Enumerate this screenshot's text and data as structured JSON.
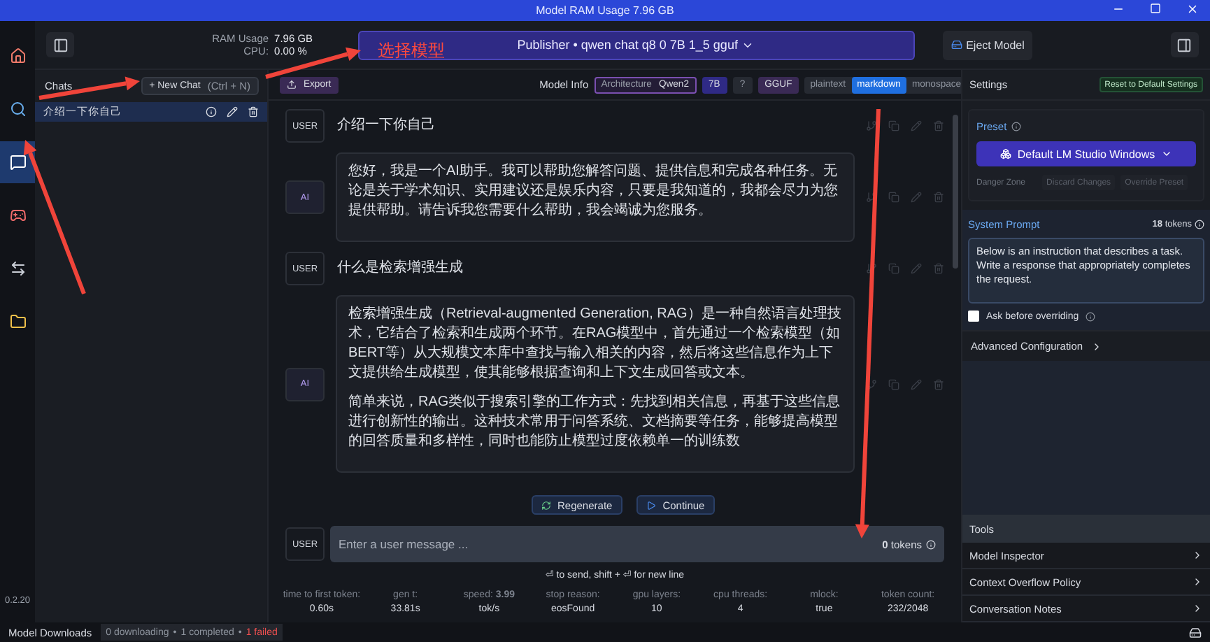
{
  "window": {
    "title": "Model RAM Usage  7.96 GB"
  },
  "nav_rail": {
    "items": [
      {
        "selected": false
      },
      {
        "selected": false
      },
      {
        "selected": true
      },
      {
        "selected": false
      },
      {
        "selected": false
      },
      {
        "selected": false
      }
    ],
    "version": "0.2.20"
  },
  "top_bar": {
    "ram_label": "RAM Usage",
    "ram_value": "7.96 GB",
    "cpu_label": "CPU:",
    "cpu_value": "0.00 %",
    "model_selector": "Publisher • qwen chat q8 0 7B 1_5 gguf",
    "eject_button": "Eject Model"
  },
  "annotation": {
    "label": "选择模型"
  },
  "chats": {
    "title": "Chats",
    "new_chat": "+ New Chat",
    "shortcut": "(Ctrl + N)",
    "items": [
      {
        "title": "介绍一下你自己",
        "selected": true
      }
    ]
  },
  "toolbar": {
    "export": "Export",
    "model_info_label": "Model Info",
    "architecture_label": "Architecture",
    "architecture_value": "Qwen2",
    "chips": [
      {
        "kind": "size",
        "label": "7B"
      },
      {
        "kind": "unknown",
        "label": "?"
      },
      {
        "kind": "format",
        "label": "GGUF"
      }
    ],
    "formats": [
      {
        "label": "plaintext",
        "selected": false
      },
      {
        "label": "markdown",
        "selected": true
      },
      {
        "label": "monospace",
        "selected": false
      }
    ]
  },
  "messages": [
    {
      "role": "USER",
      "paragraphs": [
        "介绍一下你自己"
      ]
    },
    {
      "role": "AI",
      "paragraphs": [
        "您好，我是一个AI助手。我可以帮助您解答问题、提供信息和完成各种任务。无论是关于学术知识、实用建议还是娱乐内容，只要是我知道的，我都会尽力为您提供帮助。请告诉我您需要什么帮助，我会竭诚为您服务。"
      ]
    },
    {
      "role": "USER",
      "paragraphs": [
        "什么是检索增强生成"
      ]
    },
    {
      "role": "AI",
      "paragraphs": [
        "检索增强生成（Retrieval-augmented Generation, RAG）是一种自然语言处理技术，它结合了检索和生成两个环节。在RAG模型中，首先通过一个检索模型（如BERT等）从大规模文本库中查找与输入相关的内容，然后将这些信息作为上下文提供给生成模型，使其能够根据查询和上下文生成回答或文本。",
        "简单来说，RAG类似于搜索引擎的工作方式：先找到相关信息，再基于这些信息进行创新性的输出。这种技术常用于问答系统、文档摘要等任务，能够提高模型的回答质量和多样性，同时也能防止模型过度依赖单一的训练数"
      ]
    }
  ],
  "actions": {
    "regenerate": "Regenerate",
    "continue": "Continue"
  },
  "composer": {
    "role": "USER",
    "placeholder": "Enter a user message ...",
    "tokens_value": "0",
    "tokens_label": "tokens",
    "hint": "⏎ to send, shift + ⏎ for new line"
  },
  "stats": [
    {
      "label": "time to first token:",
      "value": "0.60s"
    },
    {
      "label": "gen t:",
      "value": "33.81s"
    },
    {
      "label": "speed: **3.99**",
      "value": "tok/s"
    },
    {
      "label": "stop reason:",
      "value": "eosFound"
    },
    {
      "label": "gpu layers:",
      "value": "10"
    },
    {
      "label": "cpu threads:",
      "value": "4"
    },
    {
      "label": "mlock:",
      "value": "true"
    },
    {
      "label": "token count:",
      "value": "232/2048"
    }
  ],
  "settings": {
    "title": "Settings",
    "reset": "Reset to Default Settings",
    "preset_label": "Preset",
    "preset_value": "Default LM Studio Windows",
    "danger_zone": "Danger Zone",
    "discard": "Discard Changes",
    "override": "Override Preset",
    "system_prompt_label": "System Prompt",
    "system_prompt_tokens": "18",
    "system_prompt_tokens_label": "tokens",
    "system_prompt": "Below is an instruction that describes a task. Write a response that appropriately completes the request.",
    "ask_before_overriding": {
      "label": "Ask before overriding",
      "checked": false
    },
    "advanced": "Advanced Configuration"
  },
  "tools": {
    "title": "Tools",
    "items": [
      "Model Inspector",
      "Context Overflow Policy",
      "Conversation Notes"
    ]
  },
  "status_bar": {
    "label": "Model Downloads",
    "separator": "•",
    "parts": [
      {
        "text": "0 downloading",
        "kind": "normal"
      },
      {
        "text": "1 completed",
        "kind": "normal"
      },
      {
        "text": "1 failed",
        "kind": "error"
      }
    ]
  }
}
